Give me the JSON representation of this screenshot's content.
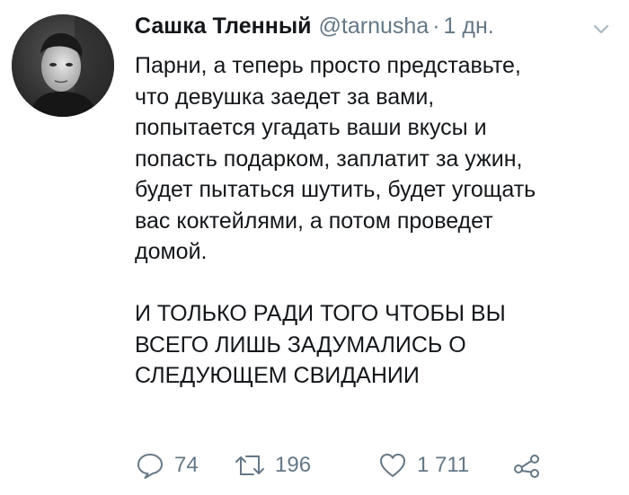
{
  "tweet": {
    "author": {
      "display_name": "Сашка Тленный",
      "handle": "@tarnusha",
      "time_separator": "·",
      "timestamp": "1 дн."
    },
    "text": "Парни, а теперь просто представьте,\nчто девушка заедет за вами,\nпопытается угадать ваши вкусы и\nпопасть подарком, заплатит за ужин,\nбудет пытаться шутить, будет угощать\nвас коктейлями, а потом проведет\nдомой.\n\nИ ТОЛЬКО РАДИ ТОГО ЧТОБЫ ВЫ\nВСЕГО ЛИШЬ ЗАДУМАЛИСЬ О\nСЛЕДУЮЩЕМ СВИДАНИИ",
    "actions": {
      "reply_count": "74",
      "retweet_count": "196",
      "like_count": "1 711"
    },
    "icons": {
      "reply": "reply-icon",
      "retweet": "retweet-icon",
      "like": "heart-icon",
      "share": "share-icon",
      "menu": "chevron-down-icon"
    },
    "colors": {
      "text": "#14171a",
      "secondary": "#657786",
      "background": "#ffffff"
    }
  }
}
